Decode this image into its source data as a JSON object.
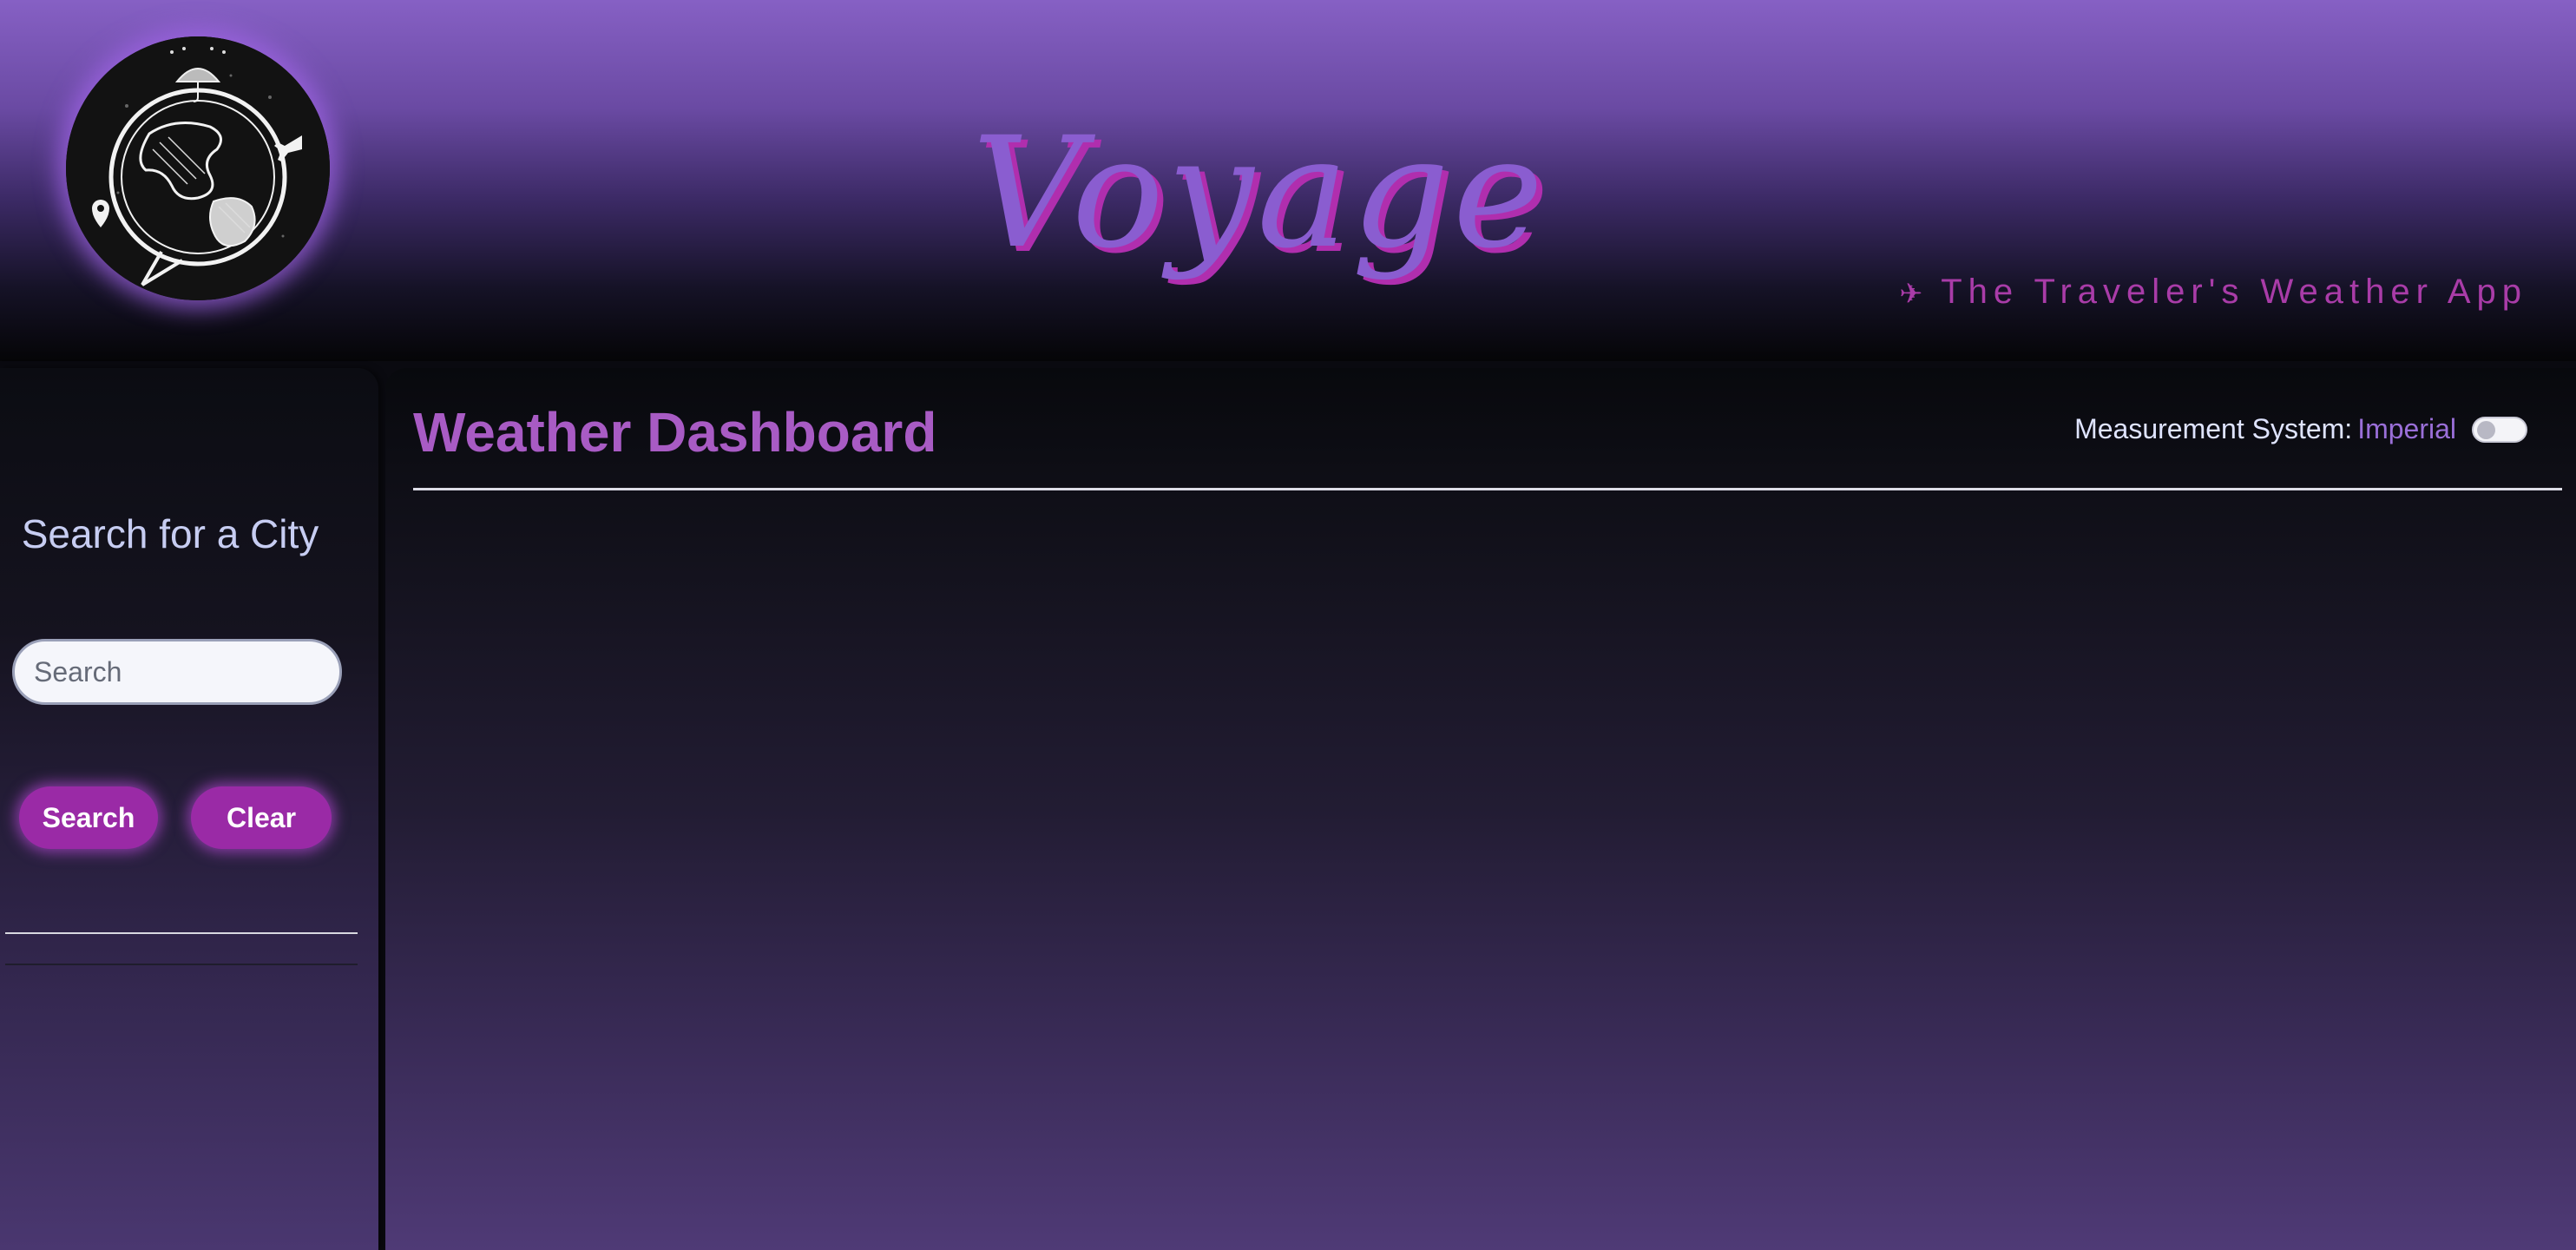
{
  "header": {
    "title": "Voyage",
    "tagline_icon": "airplane-icon",
    "tagline": "The Traveler's Weather App"
  },
  "logo": {
    "icon": "globe-weather-logo-icon"
  },
  "sidebar": {
    "title": "Search for a City",
    "search": {
      "placeholder": "Search",
      "value": ""
    },
    "buttons": {
      "search_label": "Search",
      "clear_label": "Clear"
    }
  },
  "main": {
    "title": "Weather Dashboard",
    "measurement": {
      "label": "Measurement System:",
      "value": "Imperial",
      "toggle_on": false
    }
  },
  "colors": {
    "accent": "#9a2aa6",
    "title_purple": "#a85bc4",
    "brand_purple": "#8a5dd0",
    "tagline_magenta": "#a93ca8"
  }
}
